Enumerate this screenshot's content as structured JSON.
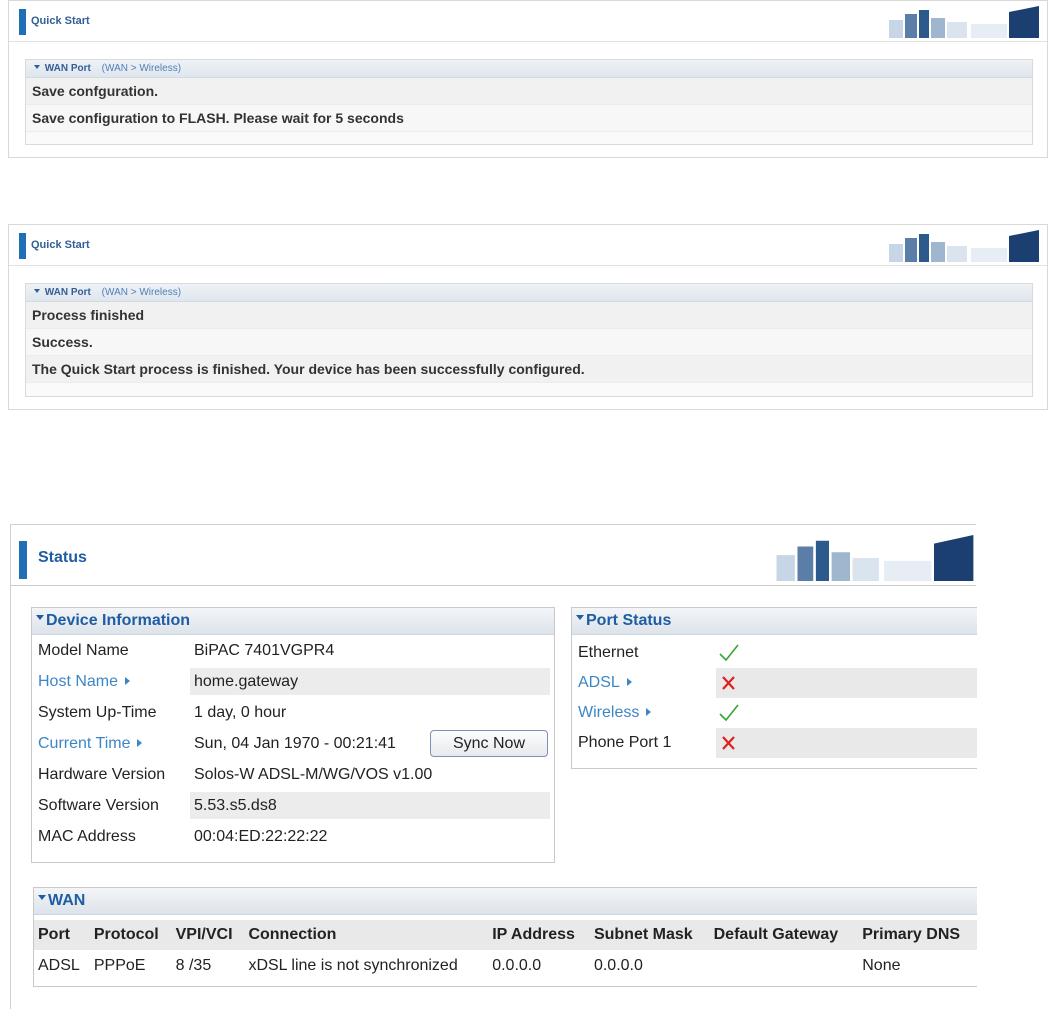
{
  "quickstart_1": {
    "title": "Quick Start",
    "section_label": "WAN Port",
    "section_path": "(WAN > Wireless)",
    "rows": [
      "Save confguration.",
      "Save configuration to FLASH. Please wait for 5 seconds"
    ]
  },
  "quickstart_2": {
    "title": "Quick Start",
    "section_label": "WAN Port",
    "section_path": "(WAN > Wireless)",
    "rows": [
      "Process finished",
      "Success.",
      "The Quick Start process is finished. Your device has been successfully configured."
    ]
  },
  "status": {
    "title": "Status",
    "device_info": {
      "heading": "Device Information",
      "model_name_label": "Model Name",
      "model_name": "BiPAC 7401VGPR4",
      "host_name_label": "Host Name",
      "host_name": "home.gateway",
      "uptime_label": "System Up-Time",
      "uptime": "1 day, 0 hour",
      "current_time_label": "Current Time",
      "current_time": "Sun, 04 Jan 1970 - 00:21:41",
      "sync_button": "Sync Now",
      "hw_version_label": "Hardware Version",
      "hw_version": "Solos-W ADSL-M/WG/VOS v1.00",
      "sw_version_label": "Software Version",
      "sw_version": "5.53.s5.ds8",
      "mac_label": "MAC Address",
      "mac": "00:04:ED:22:22:22"
    },
    "port_status": {
      "heading": "Port Status",
      "ports": [
        {
          "name": "Ethernet",
          "state": "check-icon"
        },
        {
          "name": "ADSL",
          "state": "cross-icon"
        },
        {
          "name": "Wireless",
          "state": "check-icon"
        },
        {
          "name": "Phone Port 1",
          "state": "cross-icon"
        }
      ]
    },
    "wan": {
      "heading": "WAN",
      "columns": [
        "Port",
        "Protocol",
        "VPI/VCI",
        "Connection",
        "IP Address",
        "Subnet Mask",
        "Default Gateway",
        "Primary DNS"
      ],
      "row": [
        "ADSL",
        "PPPoE",
        "8 /35",
        "xDSL line is not synchronized",
        "0.0.0.0",
        "0.0.0.0",
        "",
        "None"
      ]
    }
  },
  "colors": {
    "accent": "#1e6fb5",
    "link": "#3d86c6",
    "check": "#3aa537",
    "cross": "#e02020"
  }
}
